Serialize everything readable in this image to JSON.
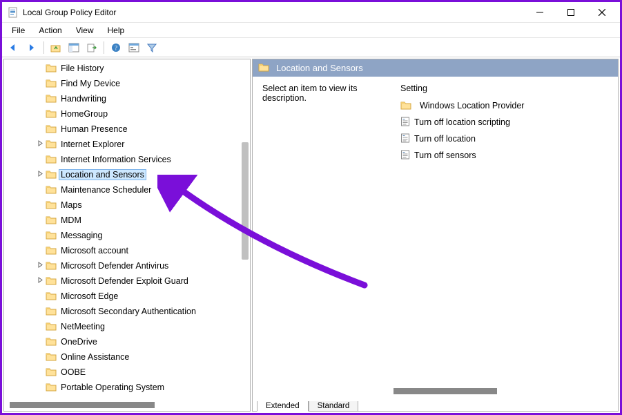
{
  "window": {
    "title": "Local Group Policy Editor"
  },
  "menu": [
    "File",
    "Action",
    "View",
    "Help"
  ],
  "toolbar_icons": [
    "back-arrow-icon",
    "forward-arrow-icon",
    "up-folder-icon",
    "show-hide-tree-icon",
    "export-list-icon",
    "help-icon",
    "properties-icon",
    "filter-icon"
  ],
  "tree": {
    "items": [
      {
        "label": "File History",
        "expandable": false,
        "selected": false
      },
      {
        "label": "Find My Device",
        "expandable": false,
        "selected": false
      },
      {
        "label": "Handwriting",
        "expandable": false,
        "selected": false
      },
      {
        "label": "HomeGroup",
        "expandable": false,
        "selected": false
      },
      {
        "label": "Human Presence",
        "expandable": false,
        "selected": false
      },
      {
        "label": "Internet Explorer",
        "expandable": true,
        "selected": false
      },
      {
        "label": "Internet Information Services",
        "expandable": false,
        "selected": false
      },
      {
        "label": "Location and Sensors",
        "expandable": true,
        "selected": true
      },
      {
        "label": "Maintenance Scheduler",
        "expandable": false,
        "selected": false
      },
      {
        "label": "Maps",
        "expandable": false,
        "selected": false
      },
      {
        "label": "MDM",
        "expandable": false,
        "selected": false
      },
      {
        "label": "Messaging",
        "expandable": false,
        "selected": false
      },
      {
        "label": "Microsoft account",
        "expandable": false,
        "selected": false
      },
      {
        "label": "Microsoft Defender Antivirus",
        "expandable": true,
        "selected": false
      },
      {
        "label": "Microsoft Defender Exploit Guard",
        "expandable": true,
        "selected": false
      },
      {
        "label": "Microsoft Edge",
        "expandable": false,
        "selected": false
      },
      {
        "label": "Microsoft Secondary Authentication",
        "expandable": false,
        "selected": false
      },
      {
        "label": "NetMeeting",
        "expandable": false,
        "selected": false
      },
      {
        "label": "OneDrive",
        "expandable": false,
        "selected": false
      },
      {
        "label": "Online Assistance",
        "expandable": false,
        "selected": false
      },
      {
        "label": "OOBE",
        "expandable": false,
        "selected": false
      },
      {
        "label": "Portable Operating System",
        "expandable": false,
        "selected": false
      }
    ]
  },
  "details": {
    "header_title": "Location and Sensors",
    "description_prompt": "Select an item to view its description.",
    "column_header": "Setting",
    "settings": [
      {
        "label": "Windows Location Provider",
        "type": "folder"
      },
      {
        "label": "Turn off location scripting",
        "type": "policy"
      },
      {
        "label": "Turn off location",
        "type": "policy"
      },
      {
        "label": "Turn off sensors",
        "type": "policy"
      }
    ]
  },
  "tabs": {
    "extended": "Extended",
    "standard": "Standard",
    "active": "extended"
  },
  "annotation": {
    "arrow_color": "#7a0fd9"
  }
}
